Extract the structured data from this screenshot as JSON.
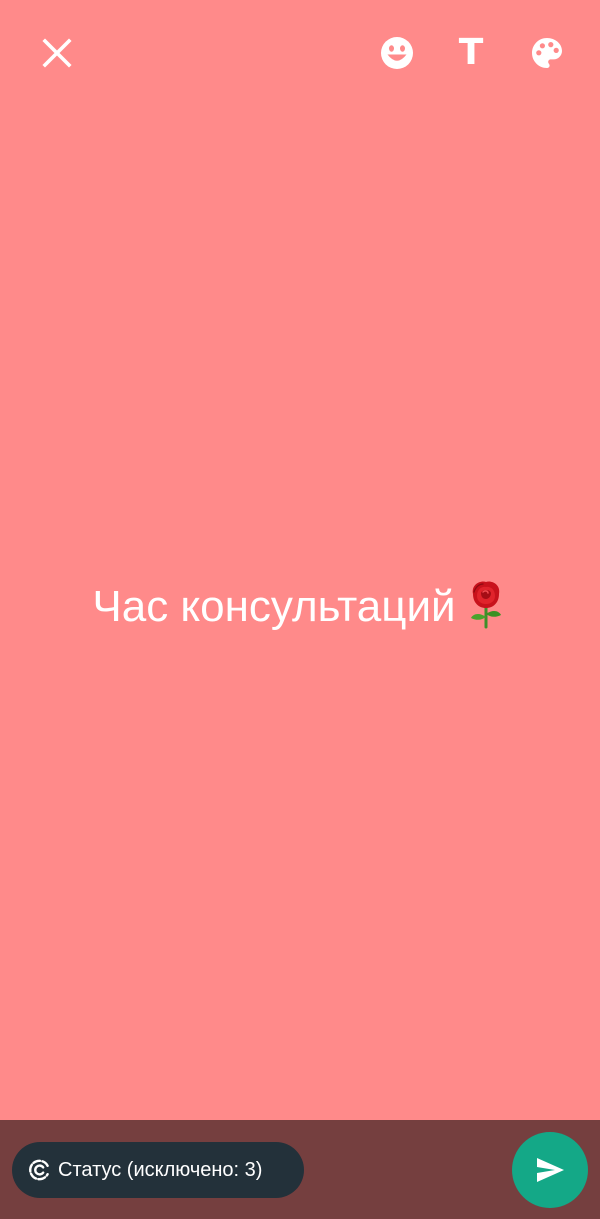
{
  "colors": {
    "background": "#ff8a8a",
    "bottom_bar": "#753f3f",
    "chip_background": "#23313a",
    "send_button": "#14a887",
    "icon": "#ffffff"
  },
  "toolbar": {
    "close_icon": "close-icon",
    "emoji_icon": "emoji-icon",
    "text_tool_label": "T",
    "palette_icon": "palette-icon"
  },
  "canvas": {
    "status_text": "Час консультаций",
    "status_emoji": "rose-emoji"
  },
  "footer": {
    "audience_icon": "status-ring-icon",
    "audience_label": "Статус (исключено: 3)",
    "send_icon": "send-icon"
  }
}
